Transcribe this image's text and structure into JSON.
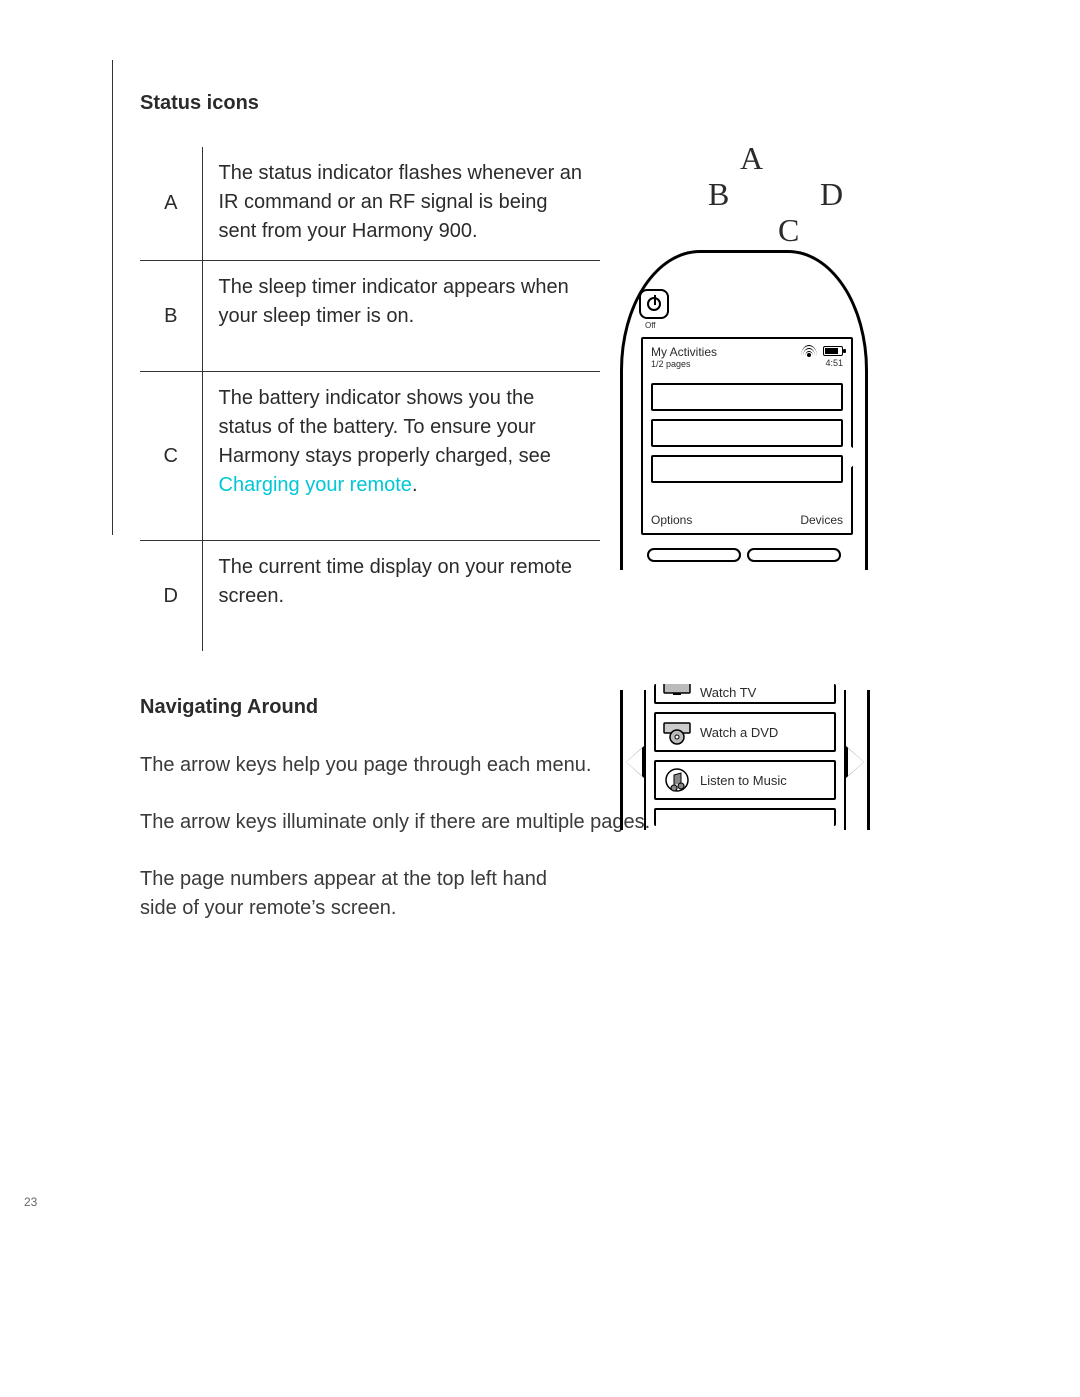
{
  "page_number": "23",
  "headings": {
    "status_icons": "Status icons",
    "navigating": "Navigating Around"
  },
  "status_rows": [
    {
      "key": "A",
      "desc": "The status indicator flashes whenever an IR command or an RF signal is being sent from your Harmony 900."
    },
    {
      "key": "B",
      "desc": "The sleep timer indicator appears when your sleep timer is on."
    },
    {
      "key": "C",
      "desc_pre": "The battery indicator shows you the status of the battery. To ensure your Harmony stays properly charged, see ",
      "desc_link": "Charging your remote",
      "desc_post": "."
    },
    {
      "key": "D",
      "desc": "The current time display on your remote screen."
    }
  ],
  "nav_paras": [
    "The arrow keys help you page through each menu.",
    "The arrow keys illuminate only if there are multiple pages.",
    "The page numbers appear at the top left hand side of your remote’s screen."
  ],
  "callouts": {
    "A": "A",
    "B": "B",
    "C": "C",
    "D": "D"
  },
  "remote_screen": {
    "off_label": "Off",
    "title": "My Activities",
    "pages": "1/2 pages",
    "time": "4:51",
    "footer_left": "Options",
    "footer_right": "Devices"
  },
  "activities": {
    "watch_tv": "Watch TV",
    "watch_dvd": "Watch a DVD",
    "listen_music": "Listen to Music"
  }
}
